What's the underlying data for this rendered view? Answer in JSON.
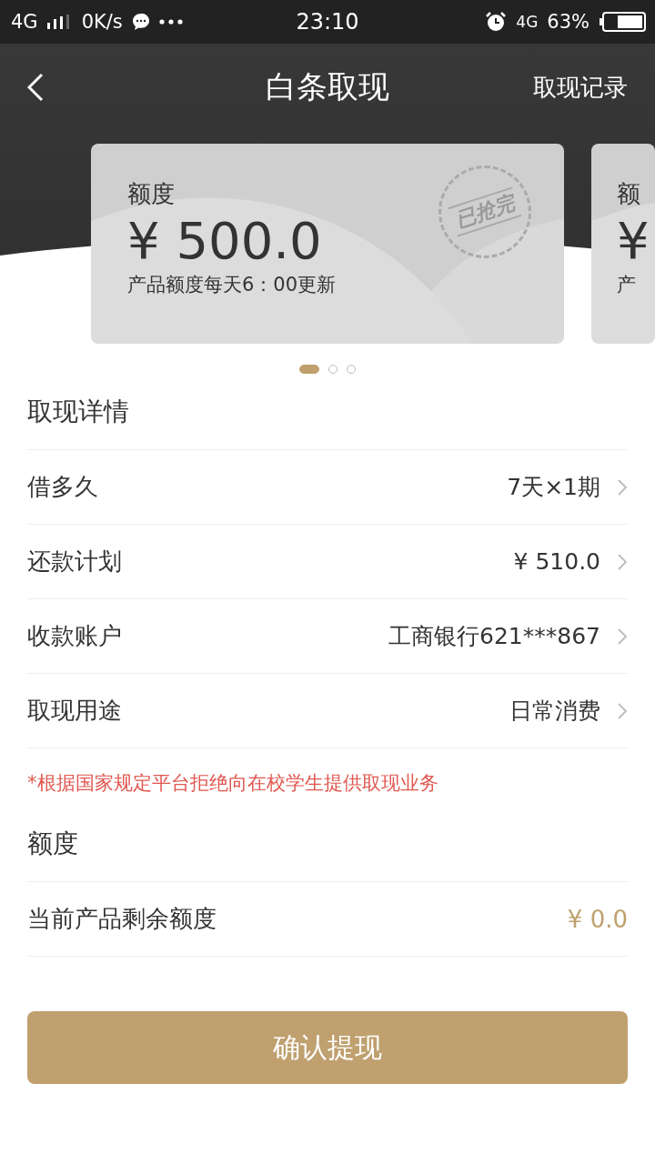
{
  "status_bar": {
    "network": "4G",
    "speed": "0K/s",
    "time": "23:10",
    "data_network": "4G",
    "battery": "63%"
  },
  "header": {
    "title": "白条取现",
    "action": "取现记录"
  },
  "cards": [
    {
      "label": "额度",
      "amount": "¥ 500.0",
      "note": "产品额度每天6：00更新",
      "stamp": "已抢完"
    },
    {
      "label": "额",
      "amount": "¥",
      "note": "产"
    }
  ],
  "pager": [
    {
      "selected": true
    },
    {
      "selected": false
    },
    {
      "selected": false
    }
  ],
  "details": {
    "title": "取现详情",
    "rows": [
      {
        "label": "借多久",
        "value": "7天×1期"
      },
      {
        "label": "还款计划",
        "value": "¥ 510.0"
      },
      {
        "label": "收款账户",
        "value": "工商银行621***867"
      },
      {
        "label": "取现用途",
        "value": "日常消费"
      }
    ]
  },
  "notice": "*根据国家规定平台拒绝向在校学生提供取现业务",
  "quota": {
    "title": "额度",
    "label": "当前产品剩余额度",
    "value": "¥ 0.0"
  },
  "confirm_button": "确认提现"
}
